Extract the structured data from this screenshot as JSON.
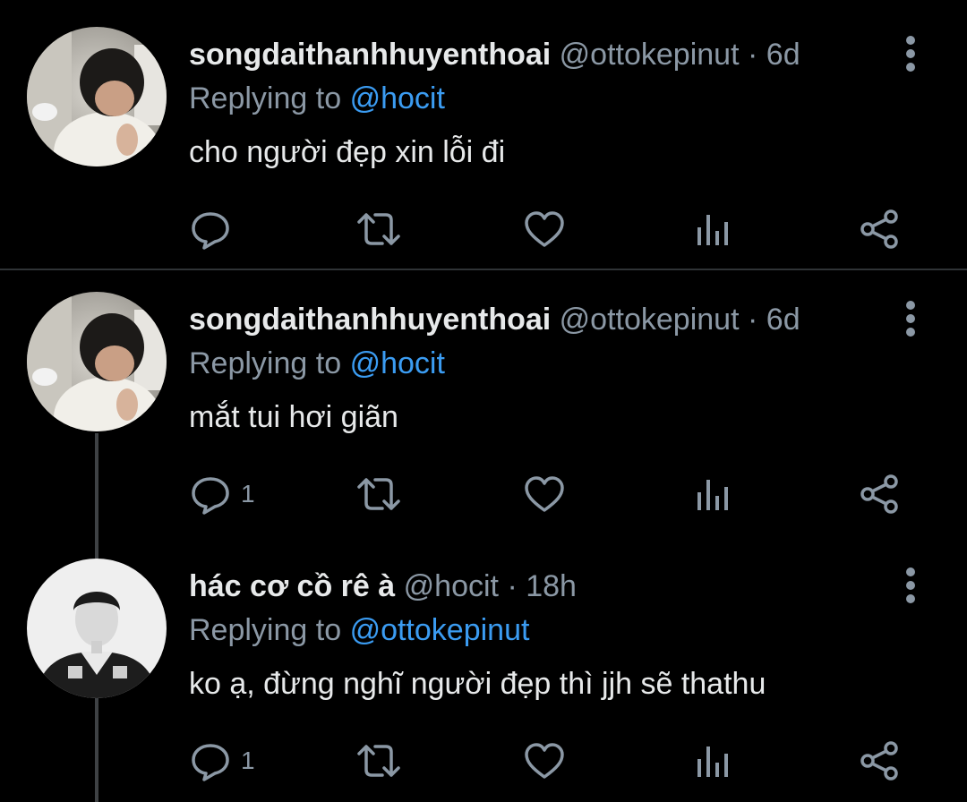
{
  "tweets": [
    {
      "name": "songdaithanhhuyenthoai",
      "handle": "@ottokepinut",
      "dot": "·",
      "time": "6d",
      "replying_prefix": "Replying to",
      "replying_to": "@hocit",
      "text": "cho người đẹp xin lỗi đi",
      "reply_count": "",
      "avatar": "avatar-photo-person-looking-down"
    },
    {
      "name": "songdaithanhhuyenthoai",
      "handle": "@ottokepinut",
      "dot": "·",
      "time": "6d",
      "replying_prefix": "Replying to",
      "replying_to": "@hocit",
      "text": "mắt tui hơi giãn",
      "reply_count": "1",
      "avatar": "avatar-photo-person-looking-down"
    },
    {
      "name": "hác cơ cồ rê à",
      "handle": "@hocit",
      "dot": "·",
      "time": "18h",
      "replying_prefix": "Replying to",
      "replying_to": "@ottokepinut",
      "text": "ko ạ, đừng nghĩ người đẹp thì jjh sẽ thathu",
      "reply_count": "1",
      "avatar": "avatar-photo-person-in-jacket"
    }
  ],
  "icons": [
    "reply-icon",
    "retweet-icon",
    "like-icon",
    "views-icon",
    "share-icon",
    "more-icon"
  ],
  "colors": {
    "background": "#000000",
    "text": "#e7e9ea",
    "muted": "#8b98a5",
    "link": "#3b9cf2",
    "divider": "#2f3336"
  }
}
